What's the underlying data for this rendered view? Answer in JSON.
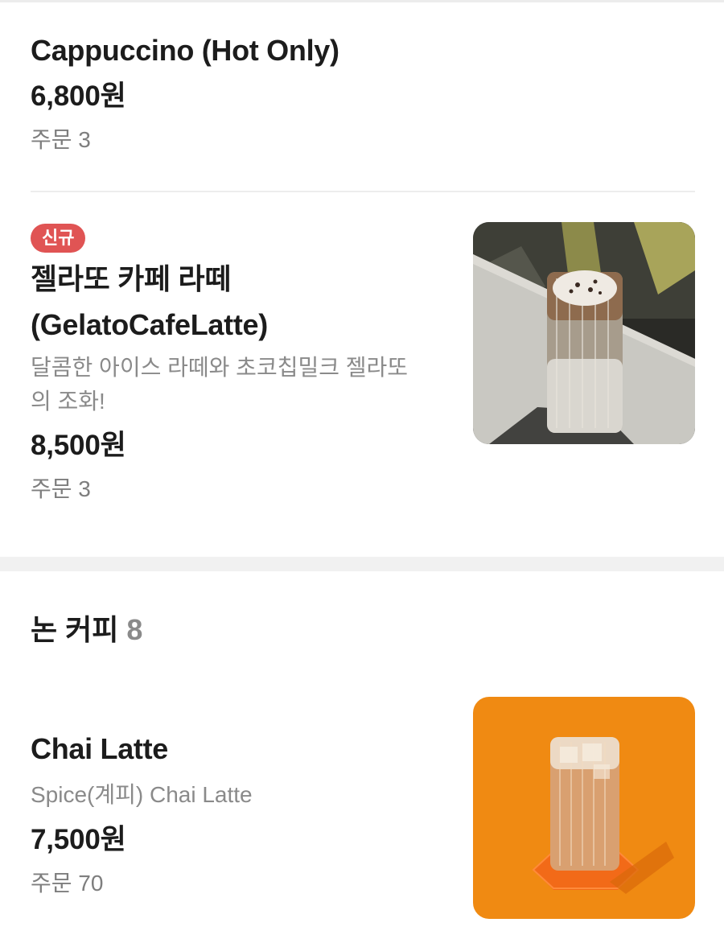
{
  "items": {
    "cappuccino": {
      "name": "Cappuccino (Hot Only)",
      "price": "6,800원",
      "orders": "주문 3"
    },
    "gelato_latte": {
      "badge": "신규",
      "name_line1": "젤라또 카페 라떼",
      "name_line2": "(GelatoCafeLatte)",
      "desc_line1": "달콤한 아이스 라떼와 초코칩밀크 젤라또",
      "desc_line2": "의 조화!",
      "price": "8,500원",
      "orders": "주문 3"
    }
  },
  "section": {
    "title": "논 커피",
    "count": "8"
  },
  "items2": {
    "chai_latte": {
      "name": "Chai Latte",
      "desc": "Spice(계피) Chai Latte",
      "price": "7,500원",
      "orders": "주문 70"
    }
  },
  "colors": {
    "badge": "#e05454",
    "chai_bg": "#f08a12"
  },
  "icons": {
    "gelato_image": "gelato-latte-photo",
    "chai_image": "chai-latte-photo"
  }
}
